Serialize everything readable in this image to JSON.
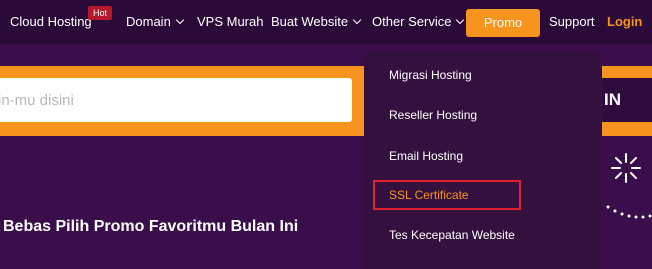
{
  "nav": {
    "cloud_hosting": "Cloud Hosting",
    "hot_badge": "Hot",
    "domain": "Domain",
    "vps_murah": "VPS Murah",
    "buat_website": "Buat Website",
    "other_service": "Other Service",
    "promo": "Promo",
    "support": "Support",
    "login": "Login"
  },
  "hero": {
    "search_placeholder": "in-mu disini",
    "search_button": "IN",
    "promo_heading": "Bebas Pilih Promo Favoritmu Bulan Ini"
  },
  "dropdown": {
    "items": [
      {
        "label": "Migrasi Hosting"
      },
      {
        "label": "Reseller Hosting"
      },
      {
        "label": "Email Hosting"
      },
      {
        "label": "SSL Certificate",
        "highlighted": true
      },
      {
        "label": "Tes Kecepatan Website"
      }
    ]
  },
  "colors": {
    "brand_orange": "#f7941d",
    "nav_background": "#2b0a39",
    "hero_background": "#3a0e4a",
    "highlight_red": "#e0202e",
    "hot_badge_red": "#b5172b"
  },
  "icons": {
    "sparkle": "sparkle-icon",
    "dotted_arc": "dotted-arc-decoration"
  }
}
